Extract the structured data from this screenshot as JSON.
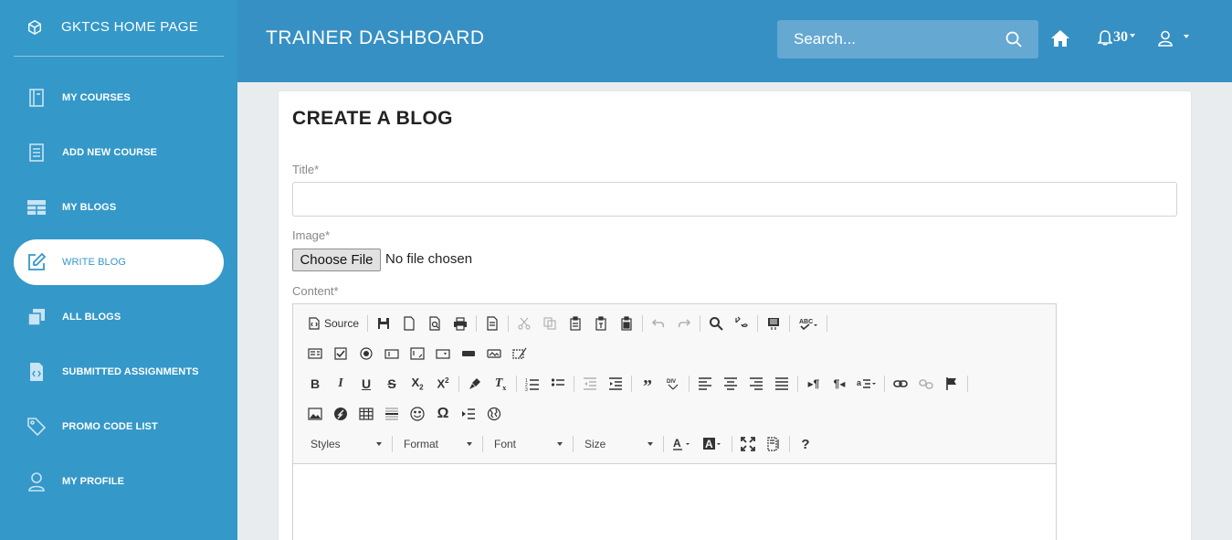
{
  "brand": {
    "label": "GKTCS HOME PAGE",
    "icon": "cube-icon"
  },
  "sidebar": {
    "items": [
      {
        "label": "MY COURSES",
        "icon": "book-icon"
      },
      {
        "label": "ADD NEW COURSE",
        "icon": "document-list-icon"
      },
      {
        "label": "MY BLOGS",
        "icon": "grid-table-icon"
      },
      {
        "label": "WRITE BLOG",
        "icon": "edit-icon",
        "active": true
      },
      {
        "label": "ALL BLOGS",
        "icon": "stacked-copy-icon"
      },
      {
        "label": "SUBMITTED ASSIGNMENTS",
        "icon": "code-file-icon"
      },
      {
        "label": "PROMO CODE LIST",
        "icon": "tags-icon"
      },
      {
        "label": "MY PROFILE",
        "icon": "user-icon"
      }
    ]
  },
  "header": {
    "title": "TRAINER DASHBOARD",
    "search_placeholder": "Search...",
    "notification_count": "30"
  },
  "form": {
    "heading": "CREATE A BLOG",
    "title_label": "Title*",
    "title_value": "",
    "image_label": "Image*",
    "file_button": "Choose File",
    "file_status": "No file chosen",
    "content_label": "Content*"
  },
  "editor": {
    "source_label": "Source",
    "styles_label": "Styles",
    "format_label": "Format",
    "font_label": "Font",
    "size_label": "Size",
    "help_label": "?"
  },
  "colors": {
    "sidebar": "#3498c9",
    "header": "#3690c4",
    "accent": "#3498c9"
  }
}
